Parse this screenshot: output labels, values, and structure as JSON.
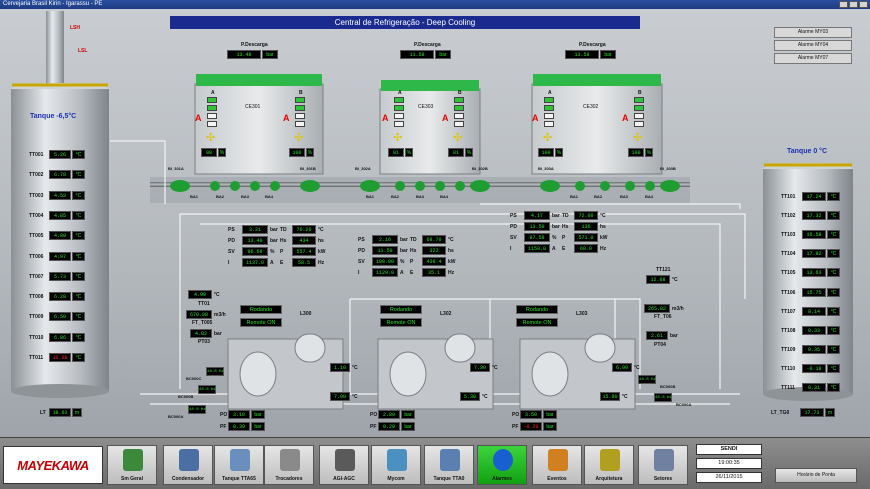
{
  "window_title": "Cervejaria Brasil Kirin - Igarassu - PE",
  "main_title": "Central de Refrigeração - Deep Cooling",
  "top_left_tags": [
    "LSH",
    "LSL"
  ],
  "alarm_buttons": [
    "Alarme MY03",
    "Alarme MY04",
    "Alarme MY07"
  ],
  "tank_left": {
    "title": "Tanque -6,5°C",
    "rows": [
      {
        "tag": "TT001",
        "value": "5.26",
        "unit": "°C"
      },
      {
        "tag": "TT002",
        "value": "6.78",
        "unit": "°C"
      },
      {
        "tag": "TT003",
        "value": "4.53",
        "unit": "°C"
      },
      {
        "tag": "TT004",
        "value": "4.85",
        "unit": "°C"
      },
      {
        "tag": "TT005",
        "value": "4.89",
        "unit": "°C"
      },
      {
        "tag": "TT006",
        "value": "4.97",
        "unit": "°C"
      },
      {
        "tag": "TT007",
        "value": "5.73",
        "unit": "°C"
      },
      {
        "tag": "TT008",
        "value": "6.28",
        "unit": "°C"
      },
      {
        "tag": "TT009",
        "value": "6.50",
        "unit": "°C"
      },
      {
        "tag": "TT010",
        "value": "6.86",
        "unit": "°C"
      },
      {
        "tag": "TT011",
        "value": "10.08",
        "unit": "°C",
        "alarm": true
      }
    ],
    "level": {
      "tag": "LT",
      "value": "18.63",
      "unit": "m"
    }
  },
  "tank_right": {
    "title": "Tanque 0 °C",
    "rows": [
      {
        "tag": "TT101",
        "value": "17.24",
        "unit": "°C"
      },
      {
        "tag": "TT102",
        "value": "17.32",
        "unit": "°C"
      },
      {
        "tag": "TT103",
        "value": "16.58",
        "unit": "°C"
      },
      {
        "tag": "TT104",
        "value": "17.82",
        "unit": "°C"
      },
      {
        "tag": "TT105",
        "value": "13.63",
        "unit": "°C"
      },
      {
        "tag": "TT106",
        "value": "15.75",
        "unit": "°C"
      },
      {
        "tag": "TT107",
        "value": "8.14",
        "unit": "°C"
      },
      {
        "tag": "TT108",
        "value": "0.33",
        "unit": "°C"
      },
      {
        "tag": "TT109",
        "value": "0.35",
        "unit": "°C"
      },
      {
        "tag": "TT110",
        "value": "-0.18",
        "unit": "°C"
      },
      {
        "tag": "TT111",
        "value": "0.31",
        "unit": "°C"
      }
    ],
    "level": {
      "tag": "LT_TG0",
      "value": "17.73",
      "unit": "m"
    }
  },
  "condensers": [
    {
      "name": "CE301",
      "label": "P.Descarga",
      "pressure": "13.48",
      "unit": "bar",
      "fan_a": "98",
      "fan_b": "100"
    },
    {
      "name": "CE303",
      "label": "P.Descarga",
      "pressure": "11.58",
      "unit": "bar",
      "fan_a": "81",
      "fan_b": "81"
    },
    {
      "name": "CE302",
      "label": "P.Descarga",
      "pressure": "13.58",
      "unit": "bar",
      "fan_a": "100",
      "fan_b": "100"
    }
  ],
  "fan_labels": [
    "A",
    "B"
  ],
  "percent_unit": "%",
  "pump_tags": [
    "BI_301A",
    "BI_301B",
    "BI_302A",
    "BI_302B",
    "BI_303A",
    "BI_303B"
  ],
  "ba_tags": [
    "BA1",
    "BA2",
    "BA3",
    "BA4",
    "BA1",
    "BA2",
    "BA3",
    "BA4",
    "BA1",
    "BA2",
    "BA3",
    "BA4"
  ],
  "compressors": [
    {
      "ps": "3.21",
      "ps_u": "bar",
      "td": "76.20",
      "td_u": "°C",
      "pd": "13.40",
      "pd_u": "bar",
      "hs": "434",
      "hs_u": "hs",
      "sv": "96.69",
      "sv_u": "%",
      "p": "557.4",
      "p_u": "kW",
      "i": "1137.0",
      "i_u": "A",
      "e": "58.5",
      "e_u": "Hz",
      "status": "Rodando",
      "mode": "Remote ON",
      "po": "3.10",
      "po_u": "bar",
      "pf": "0.39",
      "pf_u": "bar",
      "t1": "1.10",
      "t1_u": "°C",
      "t2": "7.00",
      "t2_u": "°C",
      "ldr": "L300"
    },
    {
      "ps": "2.16",
      "ps_u": "bar",
      "td": "68.70",
      "td_u": "°C",
      "pd": "11.50",
      "pd_u": "bar",
      "hs": "322",
      "hs_u": "hs",
      "sv": "100.00",
      "sv_u": "%",
      "p": "439.4",
      "p_u": "kW",
      "i": "1129.0",
      "i_u": "A",
      "e": "35.1",
      "e_u": "Hz",
      "status": "Rodando",
      "mode": "Remote ON",
      "po": "2.80",
      "po_u": "bar",
      "pf": "0.20",
      "pf_u": "bar",
      "t1": "7.30",
      "t1_u": "°C",
      "t2": "5.30",
      "t2_u": "°C",
      "ldr": "L302"
    },
    {
      "ps": "4.17",
      "ps_u": "bar",
      "td": "72.60",
      "td_u": "°C",
      "pd": "13.50",
      "pd_u": "bar",
      "hs": "136",
      "hs_u": "hs",
      "sv": "97.58",
      "sv_u": "%",
      "p": "571.0",
      "p_u": "kW",
      "i": "1150.0",
      "i_u": "A",
      "e": "60.0",
      "e_u": "Hz",
      "status": "Rodando",
      "mode": "Remote ON",
      "po": "3.50",
      "po_u": "bar",
      "pf": "-0.20",
      "pf_u": "bar",
      "t1": "6.90",
      "t1_u": "°C",
      "t2": "15.00",
      "t2_u": "°C",
      "ldr": "L303"
    }
  ],
  "param_labels": {
    "ps": "PS",
    "pd": "PD",
    "sv": "SV",
    "i": "I",
    "td": "TD",
    "hs": "Hs",
    "p": "P",
    "e": "E",
    "po": "PO",
    "pf": "PF"
  },
  "left_flow": {
    "tt": "TT01",
    "tt_val": "4.99",
    "tt_u": "°C",
    "ft": "FT_T005",
    "ft_val": "670.98",
    "ft_u": "m3/h",
    "pt_val": "4.82",
    "pt_u": "bar",
    "pt": "PT03"
  },
  "right_flow": {
    "tt": "TT121",
    "tt_val": "12.68",
    "tt_u": "°C",
    "ft": "FT_T06",
    "ft_val": "265.82",
    "ft_u": "m3/h",
    "pt_val": "2.61",
    "pt_u": "bar",
    "pt": "PT04"
  },
  "pump_groups_left": [
    {
      "tag": "BC000C",
      "hz": "48.8 Hz"
    },
    {
      "tag": "BC000B",
      "hz": "48.8 Hz"
    },
    {
      "tag": "BC000A",
      "hz": "48.8 Hz"
    }
  ],
  "pump_groups_right": [
    {
      "tag": "BC000B",
      "hz": "48.8 Hz"
    },
    {
      "tag": "BC000A",
      "hz": "48.8 Hz"
    }
  ],
  "toolbar": {
    "logo": "MAYEKAWA",
    "buttons": [
      "Sm Geral",
      "Condensador",
      "Tanque TTA65",
      "Trocadores",
      "AGI-AGC",
      "Mycom",
      "Tanque TTA0",
      "Alarmes",
      "Eventos",
      "Arquitetura",
      "Setores"
    ],
    "active": "Alarmes",
    "user": "SENDI",
    "time": "19:00:35",
    "date": "26/11/2015",
    "schedule_button": "Horário de Ponta"
  }
}
